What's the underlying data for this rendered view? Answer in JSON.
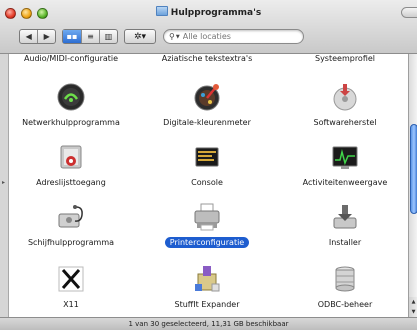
{
  "window": {
    "title": "Hulpprogramma's"
  },
  "toolbar": {
    "back_icon": "◀",
    "forward_icon": "▶",
    "view_icons": "▪▪",
    "view_list": "≡",
    "view_columns": "▥",
    "action_label": "✲▾",
    "search_placeholder": "Alle locaties"
  },
  "items": [
    {
      "label": "Audio/MIDI-configuratie",
      "icon": "midi-keyboard-icon"
    },
    {
      "label": "Aziatische tekstextra's",
      "icon": "asian-text-icon"
    },
    {
      "label": "Systeemprofiel",
      "icon": "system-profiler-icon"
    },
    {
      "label": "Netwerkhulpprogramma",
      "icon": "network-utility-icon"
    },
    {
      "label": "Digitale-kleurenmeter",
      "icon": "colorimeter-icon"
    },
    {
      "label": "Softwareherstel",
      "icon": "software-restore-icon"
    },
    {
      "label": "Adreslijsttoegang",
      "icon": "directory-access-icon"
    },
    {
      "label": "Console",
      "icon": "console-icon"
    },
    {
      "label": "Activiteitenweergave",
      "icon": "activity-monitor-icon"
    },
    {
      "label": "Schijfhulpprogramma",
      "icon": "disk-utility-icon"
    },
    {
      "label": "Printerconfiguratie",
      "icon": "printer-icon",
      "selected": true
    },
    {
      "label": "Installer",
      "icon": "installer-icon"
    },
    {
      "label": "X11",
      "icon": "x11-icon"
    },
    {
      "label": "StuffIt Expander",
      "icon": "stuffit-icon"
    },
    {
      "label": "ODBC-beheer",
      "icon": "odbc-icon"
    }
  ],
  "status": {
    "text": "1 van 30 geselecteerd, 11,31 GB beschikbaar"
  },
  "colors": {
    "selection": "#1e5dcf"
  }
}
